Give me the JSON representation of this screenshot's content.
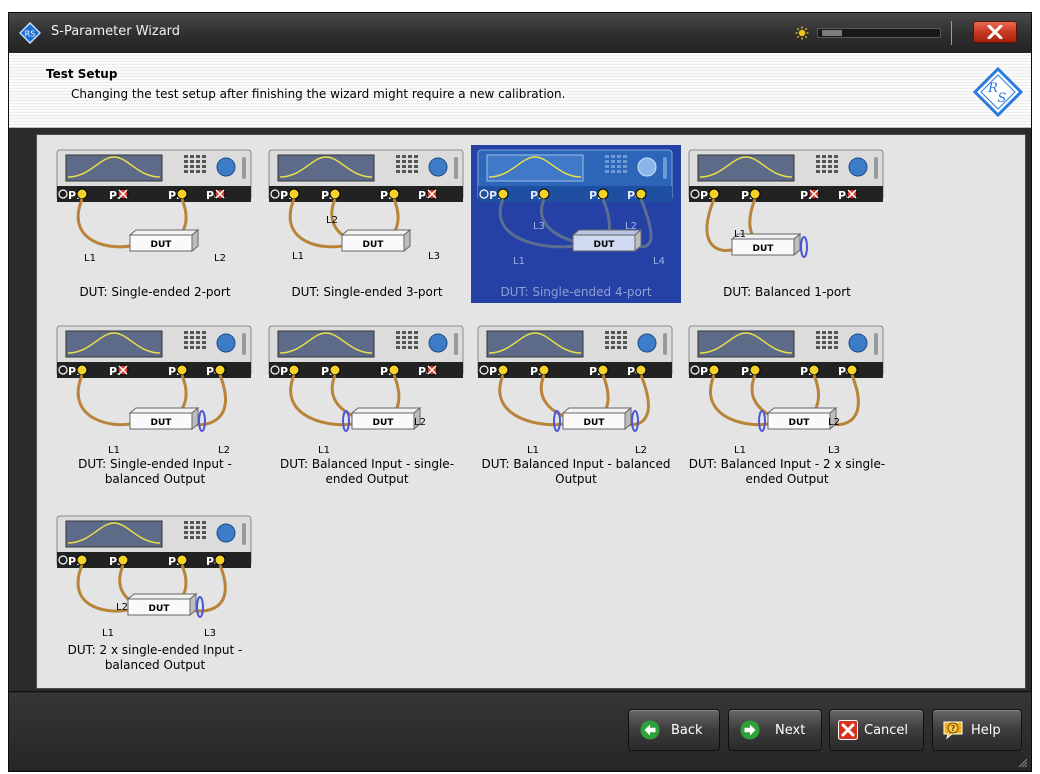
{
  "window": {
    "title": "S-Parameter Wizard"
  },
  "header": {
    "title": "Test Setup",
    "description": "Changing the test setup after finishing the wizard might require a new calibration."
  },
  "setups": [
    {
      "label": "DUT: Single-ended 2-port",
      "selected": false
    },
    {
      "label": "DUT: Single-ended 3-port",
      "selected": false
    },
    {
      "label": "DUT: Single-ended 4-port",
      "selected": true
    },
    {
      "label": "DUT: Balanced 1-port",
      "selected": false
    },
    {
      "label": "DUT: Single-ended Input - balanced Output",
      "selected": false
    },
    {
      "label": "DUT: Balanced Input - single-ended Output",
      "selected": false
    },
    {
      "label": "DUT: Balanced Input - balanced Output",
      "selected": false
    },
    {
      "label": "DUT: Balanced Input - 2 x single-ended Output",
      "selected": false
    },
    {
      "label": "DUT: 2 x single-ended Input - balanced Output",
      "selected": false
    }
  ],
  "thumbnails": [
    {
      "ports": [
        "ok",
        "x",
        "ok",
        "x"
      ],
      "leads": [
        "L1",
        "L2"
      ],
      "dut": "DUT"
    },
    {
      "ports": [
        "ok",
        "ok",
        "ok",
        "x"
      ],
      "leads": [
        "L1",
        "L2",
        "L3"
      ],
      "dut": "DUT"
    },
    {
      "ports": [
        "ok",
        "ok",
        "ok",
        "ok"
      ],
      "leads": [
        "L1",
        "L3",
        "L2",
        "L4"
      ],
      "dut": "DUT"
    },
    {
      "ports": [
        "ok",
        "ok",
        "x",
        "x"
      ],
      "leads": [
        "L1"
      ],
      "dut": "DUT"
    },
    {
      "ports": [
        "ok",
        "x",
        "ok",
        "ok"
      ],
      "leads": [
        "L1",
        "L2"
      ],
      "dut": "DUT"
    },
    {
      "ports": [
        "ok",
        "ok",
        "ok",
        "x"
      ],
      "leads": [
        "L1",
        "L2"
      ],
      "dut": "DUT"
    },
    {
      "ports": [
        "ok",
        "ok",
        "ok",
        "ok"
      ],
      "leads": [
        "L1",
        "L2"
      ],
      "dut": "DUT"
    },
    {
      "ports": [
        "ok",
        "ok",
        "ok",
        "ok"
      ],
      "leads": [
        "L1",
        "L2",
        "L3"
      ],
      "dut": "DUT"
    },
    {
      "ports": [
        "ok",
        "ok",
        "ok",
        "ok"
      ],
      "leads": [
        "L1",
        "L2",
        "L3"
      ],
      "dut": "DUT"
    }
  ],
  "port_labels": [
    "P1",
    "P3",
    "P2",
    "P4"
  ],
  "footer": {
    "back_label": "Back",
    "next_label": "Next",
    "cancel_label": "Cancel",
    "help_label": "Help"
  },
  "icons": {
    "app": "rs-app-icon",
    "brightness": "sun-icon",
    "close": "close-icon",
    "back": "arrow-left-icon",
    "next": "arrow-right-icon",
    "cancel": "cancel-x-icon",
    "help": "help-question-icon"
  },
  "colors": {
    "selection": "#2541a5",
    "selected_text": "#8e9fd4",
    "close_button": "#c73a22",
    "cable": "#b8843a",
    "balun": "#4a55d8",
    "arrow_green": "#2ea23a",
    "help_yellow": "#f3b21a"
  }
}
